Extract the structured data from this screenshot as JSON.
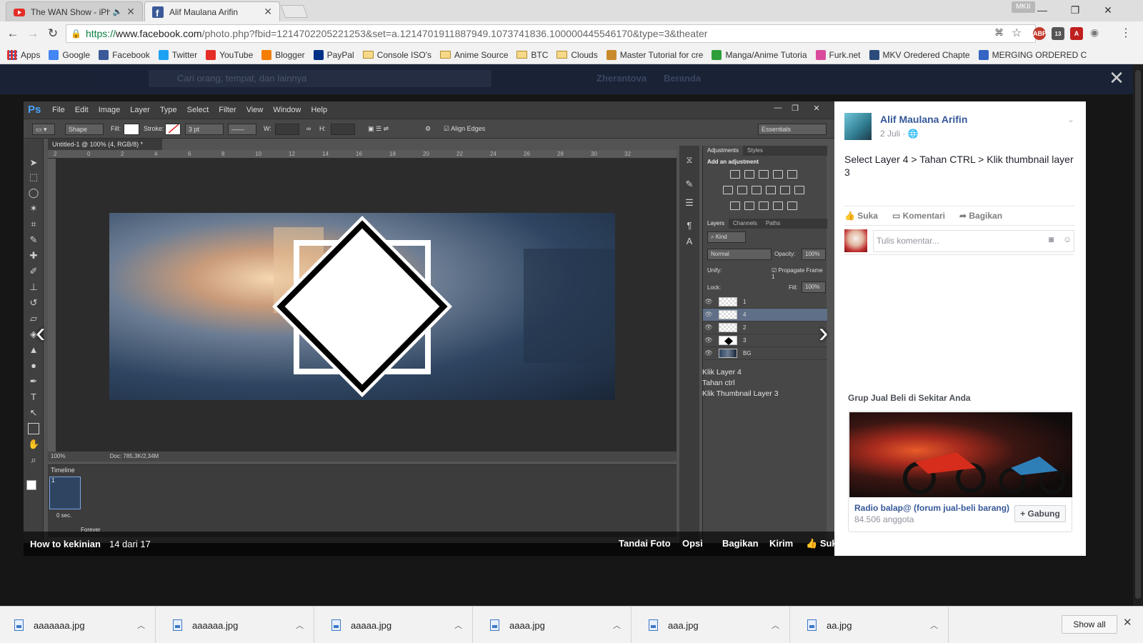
{
  "browser": {
    "tabs": [
      {
        "label": "The WAN Show - iPho",
        "icon": "youtube-icon"
      },
      {
        "label": "Alif Maulana Arifin",
        "icon": "facebook-icon"
      }
    ],
    "profile_badge": "MKII",
    "url": {
      "scheme": "https://",
      "host": "www.facebook.com",
      "path": "/photo.php?fbid=1214702205221253&set=a.1214701911887949.1073741836.100000445546170&type=3&theater"
    },
    "extensions": [
      {
        "name": "abp-icon",
        "label": "ABP",
        "color": "#c0392b"
      },
      {
        "name": "notifications-icon",
        "label": "13",
        "color": "#555555"
      }
    ],
    "bookmarks": [
      {
        "label": "Apps",
        "kind": "apps"
      },
      {
        "label": "Google",
        "kind": "google"
      },
      {
        "label": "Facebook",
        "kind": "facebook"
      },
      {
        "label": "Twitter",
        "kind": "twitter"
      },
      {
        "label": "YouTube",
        "kind": "youtube"
      },
      {
        "label": "Blogger",
        "kind": "blogger"
      },
      {
        "label": "PayPal",
        "kind": "paypal"
      },
      {
        "label": "Console ISO's",
        "kind": "folder"
      },
      {
        "label": "Anime Source",
        "kind": "folder"
      },
      {
        "label": "BTC",
        "kind": "folder"
      },
      {
        "label": "Clouds",
        "kind": "folder"
      },
      {
        "label": "Master Tutorial for cre",
        "kind": "tutorial"
      },
      {
        "label": "Manga/Anime Tutoria",
        "kind": "manga"
      },
      {
        "label": "Furk.net",
        "kind": "furk"
      },
      {
        "label": "MKV Oredered Chapte",
        "kind": "mkv"
      },
      {
        "label": "MERGING ORDERED C",
        "kind": "merging"
      }
    ]
  },
  "facebook": {
    "search_placeholder": "Cari orang, tempat, dan lainnya",
    "topbar_user": "Zherantova",
    "topbar_home": "Beranda"
  },
  "photoshop": {
    "logo": "Ps",
    "menus": [
      "File",
      "Edit",
      "Image",
      "Layer",
      "Type",
      "Select",
      "Filter",
      "View",
      "Window",
      "Help"
    ],
    "options": {
      "tool_mode": "Shape",
      "fill_label": "Fill:",
      "stroke_label": "Stroke:",
      "stroke_width": "3 pt",
      "w_label": "W:",
      "h_label": "H:",
      "align_edges": "Align Edges",
      "workspace": "Essentials"
    },
    "doc_tab": "Untitled-1 @ 100% (4, RGB/8) *",
    "ruler_ticks": [
      "2",
      "0",
      "2",
      "4",
      "6",
      "8",
      "10",
      "12",
      "14",
      "16",
      "18",
      "20",
      "22",
      "24",
      "26",
      "28",
      "30",
      "32"
    ],
    "status": {
      "zoom": "100%",
      "doc": "Doc: 785,3K/2,34M"
    },
    "timeline": {
      "title": "Timeline",
      "frame_number": "1",
      "frame_delay": "0 sec.",
      "loop": "Forever"
    },
    "adjustments": {
      "tabs": [
        "Adjustments",
        "Styles"
      ],
      "heading": "Add an adjustment"
    },
    "layers_panel": {
      "tabs": [
        "Layers",
        "Channels",
        "Paths"
      ],
      "filter_kind": "Kind",
      "blend_mode": "Normal",
      "opacity_label": "Opacity:",
      "opacity": "100%",
      "unify_label": "Unify:",
      "propagate": "Propagate Frame 1",
      "lock_label": "Lock:",
      "fill_label": "Fill:",
      "fill": "100%",
      "layers": [
        {
          "name": "1",
          "selected": false
        },
        {
          "name": "4",
          "selected": true
        },
        {
          "name": "2",
          "selected": false
        },
        {
          "name": "3",
          "selected": false
        },
        {
          "name": "BG",
          "selected": false
        }
      ]
    },
    "note_lines": [
      "Klik Layer 4",
      "Tahan ctrl",
      "Klik Thumbnail Layer 3"
    ]
  },
  "viewer": {
    "album_title": "How to kekinian",
    "photo_count": "14 dari 17",
    "actions": {
      "tag": "Tandai Foto",
      "options": "Opsi",
      "share": "Bagikan",
      "send": "Kirim",
      "like": "Suka"
    }
  },
  "post": {
    "author": "Alif Maulana Arifin",
    "date": "2 Juli",
    "caption": "Select Layer 4 > Tahan CTRL > Klik thumbnail layer 3",
    "actions": {
      "like": "Suka",
      "comment": "Komentari",
      "share": "Bagikan"
    },
    "comment_placeholder": "Tulis komentar..."
  },
  "suggested_group": {
    "section_title": "Grup Jual Beli di Sekitar Anda",
    "name": "Radio balap@ (forum jual-beli barang)",
    "members": "84.506 anggota",
    "join_label": "+ Gabung"
  },
  "downloads": {
    "items": [
      "aaaaaaa.jpg",
      "aaaaaa.jpg",
      "aaaaa.jpg",
      "aaaa.jpg",
      "aaa.jpg",
      "aa.jpg"
    ],
    "show_all": "Show all"
  }
}
